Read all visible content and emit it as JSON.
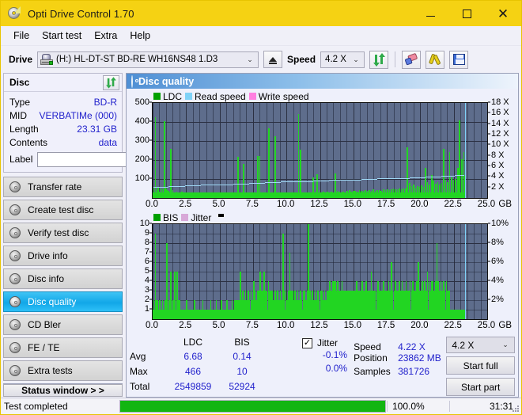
{
  "window": {
    "title": "Opti Drive Control 1.70",
    "icon": "disc-icon",
    "controls": {
      "minimize": "–",
      "maximize": "□",
      "close": "✕"
    }
  },
  "menu": {
    "items": [
      "File",
      "Start test",
      "Extra",
      "Help"
    ]
  },
  "toolbar": {
    "drive_label": "Drive",
    "drive_value": "(H:)   HL-DT-ST BD-RE  WH16NS48 1.D3",
    "eject": "eject-icon",
    "speed_label": "Speed",
    "speed_value": "4.2 X",
    "refresh": "refresh-icon",
    "eraser": "eraser-icon",
    "tools": "tools-icon",
    "save": "save-icon",
    "caret": "⌄"
  },
  "disc_panel": {
    "title": "Disc",
    "refresh_icon": "refresh-icon",
    "rows": [
      {
        "key": "Type",
        "value": "BD-R"
      },
      {
        "key": "MID",
        "value": "VERBATIMe (000)"
      },
      {
        "key": "Length",
        "value": "23.31 GB"
      },
      {
        "key": "Contents",
        "value": "data"
      }
    ],
    "label_key": "Label",
    "label_value": "",
    "label_placeholder": "",
    "label_button_icon": "cd-icon"
  },
  "nav": {
    "items": [
      {
        "label": "Transfer rate",
        "active": false
      },
      {
        "label": "Create test disc",
        "active": false
      },
      {
        "label": "Verify test disc",
        "active": false
      },
      {
        "label": "Drive info",
        "active": false
      },
      {
        "label": "Disc info",
        "active": false
      },
      {
        "label": "Disc quality",
        "active": true
      },
      {
        "label": "CD Bler",
        "active": false
      },
      {
        "label": "FE / TE",
        "active": false
      },
      {
        "label": "Extra tests",
        "active": false
      }
    ],
    "status_window": "Status window > >"
  },
  "panel": {
    "title": "Disc quality",
    "icon": "disc-quality-icon"
  },
  "chart_data": [
    {
      "type": "bar",
      "title": "LDC",
      "xlabel": "GB",
      "ylabel": "",
      "legend": [
        {
          "label": "LDC",
          "color": "#00a000"
        },
        {
          "label": "Read speed",
          "color": "#7fd2f7"
        },
        {
          "label": "Write speed",
          "color": "#ff7fe0"
        }
      ],
      "legend_position": "top-left",
      "grid": true,
      "xlim": [
        0,
        25.0
      ],
      "xticks": [
        "0.0",
        "2.5",
        "5.0",
        "7.5",
        "10.0",
        "12.5",
        "15.0",
        "17.5",
        "20.0",
        "22.5",
        "25.0"
      ],
      "xunit": "GB",
      "ylim": [
        0,
        500
      ],
      "yticks": [
        100,
        200,
        300,
        400,
        500
      ],
      "y2lim": [
        0,
        18
      ],
      "y2ticks": [
        "2 X",
        "4 X",
        "6 X",
        "8 X",
        "10 X",
        "12 X",
        "14 X",
        "16 X",
        "18 X"
      ],
      "series": [
        {
          "name": "LDC",
          "color": "#22d522",
          "x": [
            0.05,
            0.15,
            0.28,
            0.36,
            0.45,
            0.58,
            0.7,
            0.85,
            0.95,
            1.05,
            1.15,
            1.3,
            1.45,
            1.6,
            1.75,
            1.9,
            2.0,
            2.15,
            2.3,
            2.45,
            2.6,
            2.75,
            2.9,
            3.05,
            3.2,
            3.35,
            3.5,
            3.65,
            3.8,
            3.95,
            4.1,
            4.25,
            4.4,
            4.55,
            4.7,
            4.85,
            5.0,
            5.15,
            5.3,
            5.45,
            5.6,
            5.75,
            5.9,
            6.05,
            6.2,
            6.35,
            6.5,
            6.62,
            6.75,
            6.9,
            7.05,
            7.2,
            7.35,
            7.5,
            7.65,
            7.8,
            7.95,
            8.1,
            8.25,
            8.4,
            8.5,
            8.65,
            8.8,
            8.95,
            9.1,
            9.25,
            9.4,
            9.55,
            9.7,
            9.85,
            9.95,
            10.1,
            10.25,
            10.4,
            10.55,
            10.7,
            10.85,
            11.0,
            11.15,
            11.3,
            11.45,
            11.6,
            11.75,
            11.9,
            11.95,
            12.1,
            12.25,
            12.4,
            12.55,
            12.7,
            12.85,
            13.0,
            13.15,
            13.3,
            13.45,
            13.6,
            13.75,
            13.9,
            14.05,
            14.2,
            14.35,
            14.5,
            14.65,
            14.8,
            14.95,
            15.1,
            15.25,
            15.4,
            15.55,
            15.7,
            15.85,
            16.0,
            16.15,
            16.3,
            16.45,
            16.6,
            16.75,
            16.9,
            17.05,
            17.2,
            17.35,
            17.5,
            17.65,
            17.8,
            17.95,
            18.1,
            18.25,
            18.4,
            18.55,
            18.7,
            18.85,
            19.0,
            19.15,
            19.3,
            19.45,
            19.6,
            19.75,
            19.9,
            20.05,
            20.2,
            20.35,
            20.5,
            20.65,
            20.8,
            20.95,
            21.1,
            21.25,
            21.4,
            21.55,
            21.7,
            21.85,
            22.0,
            22.15,
            22.3,
            22.45,
            22.6,
            22.75,
            22.9,
            23.05,
            23.2,
            23.3
          ],
          "values": [
            60,
            425,
            40,
            58,
            35,
            52,
            45,
            404,
            50,
            42,
            38,
            258,
            40,
            30,
            34,
            28,
            30,
            32,
            26,
            24,
            28,
            22,
            26,
            24,
            20,
            22,
            26,
            24,
            20,
            22,
            24,
            20,
            26,
            22,
            20,
            24,
            18,
            20,
            24,
            22,
            20,
            24,
            26,
            20,
            22,
            218,
            28,
            24,
            180,
            26,
            30,
            24,
            28,
            22,
            26,
            220,
            222,
            30,
            24,
            28,
            26,
            368,
            30,
            24,
            325,
            28,
            26,
            30,
            24,
            28,
            26,
            30,
            24,
            26,
            30,
            24,
            440,
            255,
            28,
            24,
            30,
            26,
            24,
            28,
            110,
            32,
            125,
            40,
            30,
            34,
            30,
            34,
            28,
            32,
            30,
            130,
            36,
            32,
            28,
            34,
            30,
            36,
            40,
            34,
            36,
            38,
            34,
            40,
            36,
            38,
            42,
            38,
            40,
            36,
            44,
            38,
            40,
            42,
            38,
            44,
            40,
            46,
            42,
            44,
            48,
            44,
            46,
            50,
            44,
            48,
            52,
            268,
            80,
            62,
            70,
            56,
            64,
            58,
            66,
            60,
            160,
            82,
            70,
            120,
            90,
            75,
            85,
            70,
            80,
            260,
            95,
            85,
            240,
            110,
            90,
            100,
            160,
            410,
            205,
            240,
            120
          ]
        },
        {
          "name": "Read speed",
          "color": "#9fd8f5",
          "description": "rising stepped line from ~2.1X at 0 GB to ~4.3X at 23.3 GB",
          "x": [
            0.05,
            1.2,
            2.4,
            3.6,
            4.8,
            6.0,
            7.2,
            8.4,
            9.6,
            10.8,
            12.0,
            13.2,
            14.4,
            15.6,
            16.8,
            18.0,
            19.2,
            20.4,
            21.6,
            22.6,
            23.3
          ],
          "values": [
            2.1,
            2.2,
            2.35,
            2.5,
            2.6,
            2.75,
            2.85,
            3.0,
            3.1,
            3.2,
            3.3,
            3.4,
            3.5,
            3.6,
            3.7,
            3.8,
            3.9,
            4.0,
            4.15,
            4.3,
            4.3
          ]
        },
        {
          "name": "Write speed",
          "color": "#ff7fe0",
          "x": [],
          "values": []
        }
      ],
      "endline": {
        "x": 23.35,
        "label": "end-of-data marker",
        "color": "#7fd2f7"
      }
    },
    {
      "type": "bar",
      "title": "BIS",
      "xlabel": "GB",
      "legend": [
        {
          "label": "BIS",
          "color": "#00a000"
        },
        {
          "label": "Jitter",
          "color": "#d8a8d8"
        }
      ],
      "legend_position": "top-left",
      "grid": true,
      "xlim": [
        0,
        25.0
      ],
      "xticks": [
        "0.0",
        "2.5",
        "5.0",
        "7.5",
        "10.0",
        "12.5",
        "15.0",
        "17.5",
        "20.0",
        "22.5",
        "25.0"
      ],
      "xunit": "GB",
      "ylim": [
        0,
        10
      ],
      "yticks": [
        1,
        2,
        3,
        4,
        5,
        6,
        7,
        8,
        9,
        10
      ],
      "y2lim": [
        0,
        10
      ],
      "y2ticks": [
        "2%",
        "4%",
        "6%",
        "8%",
        "10%"
      ],
      "series": [
        {
          "name": "BIS",
          "color": "#22d522",
          "x": [
            0.05,
            0.15,
            0.25,
            0.3,
            0.4,
            0.5,
            0.6,
            0.7,
            0.8,
            0.9,
            1.0,
            1.1,
            1.2,
            1.3,
            1.4,
            1.5,
            1.6,
            1.7,
            1.8,
            1.9,
            2.0,
            2.1,
            2.2,
            2.3,
            2.4,
            2.5,
            2.6,
            2.7,
            2.8,
            2.9,
            3.0,
            3.1,
            3.2,
            3.3,
            3.4,
            3.5,
            3.6,
            3.7,
            3.8,
            3.9,
            4.0,
            4.1,
            4.2,
            4.3,
            4.4,
            4.5,
            4.6,
            4.7,
            4.8,
            4.9,
            5.0,
            5.1,
            5.2,
            5.3,
            5.4,
            5.5,
            5.6,
            5.7,
            5.8,
            5.9,
            6.0,
            6.1,
            6.2,
            6.3,
            6.4,
            6.5,
            6.6,
            6.7,
            6.8,
            6.9,
            7.0,
            7.1,
            7.2,
            7.3,
            7.4,
            7.5,
            7.6,
            7.7,
            7.8,
            7.9,
            8.0,
            8.1,
            8.2,
            8.3,
            8.4,
            8.5,
            8.6,
            8.7,
            8.8,
            8.9,
            9.0,
            9.1,
            9.2,
            9.3,
            9.4,
            9.5,
            9.6,
            9.7,
            9.8,
            9.9,
            10.0,
            10.1,
            10.2,
            10.3,
            10.4,
            10.5,
            10.6,
            10.7,
            10.8,
            10.9,
            11.0,
            11.1,
            11.2,
            11.3,
            11.4,
            11.5,
            11.6,
            11.7,
            11.8,
            11.9,
            12.0,
            12.1,
            12.2,
            12.3,
            12.4,
            12.5,
            12.6,
            12.7,
            12.8,
            12.9,
            13.0,
            13.1,
            13.2,
            13.3,
            13.4,
            13.5,
            13.6,
            13.7,
            13.8,
            13.9,
            14.0,
            14.1,
            14.2,
            14.3,
            14.4,
            14.5,
            14.6,
            14.7,
            14.8,
            14.9,
            15.0,
            15.1,
            15.2,
            15.3,
            15.4,
            15.5,
            15.6,
            15.7,
            15.8,
            15.9,
            16.0,
            16.1,
            16.2,
            16.3,
            16.4,
            16.5,
            16.6,
            16.7,
            16.8,
            16.9,
            17.0,
            17.1,
            17.2,
            17.3,
            17.4,
            17.5,
            17.6,
            17.7,
            17.8,
            17.9,
            18.0,
            18.1,
            18.2,
            18.3,
            18.4,
            18.5,
            18.6,
            18.7,
            18.8,
            18.9,
            19.0,
            19.1,
            19.2,
            19.3,
            19.4,
            19.5,
            19.6,
            19.7,
            19.8,
            19.9,
            20.0,
            20.1,
            20.2,
            20.3,
            20.4,
            20.5,
            20.6,
            20.7,
            20.8,
            20.9,
            21.0,
            21.1,
            21.2,
            21.3,
            21.4,
            21.5,
            21.6,
            21.7,
            21.8,
            21.9,
            22.0,
            22.1,
            22.2,
            22.3,
            22.4,
            22.5,
            22.6,
            22.7,
            22.8,
            22.9,
            23.0,
            23.1,
            23.2,
            23.3
          ],
          "values": [
            2,
            9,
            2,
            2,
            1,
            2,
            1,
            2,
            1,
            2,
            8,
            1,
            2,
            5,
            1,
            2,
            5,
            1,
            5,
            2,
            2,
            1,
            1,
            1,
            1,
            2,
            1,
            1,
            1,
            1,
            1,
            2,
            1,
            1,
            1,
            1,
            1,
            2,
            1,
            1,
            1,
            1,
            1,
            2,
            1,
            1,
            1,
            2,
            1,
            1,
            1,
            2,
            1,
            1,
            1,
            2,
            1,
            1,
            1,
            2,
            1,
            2,
            2,
            2,
            2,
            5,
            2,
            3,
            2,
            3,
            2,
            3,
            2,
            3,
            2,
            4,
            3,
            2,
            3,
            3,
            5,
            3,
            3,
            5,
            3,
            3,
            4,
            3,
            3,
            3,
            2,
            3,
            2,
            3,
            2,
            3,
            2,
            9,
            3,
            3,
            2,
            3,
            7,
            3,
            3,
            2,
            3,
            2,
            3,
            2,
            3,
            2,
            3,
            3,
            2,
            3,
            10,
            3,
            2,
            3,
            2,
            3,
            2,
            3,
            2,
            3,
            3,
            2,
            3,
            2,
            3,
            3,
            4,
            3,
            4,
            4,
            4,
            3,
            4,
            3,
            3,
            4,
            3,
            3,
            3,
            3,
            3,
            3,
            3,
            3,
            3,
            3,
            4,
            3,
            3,
            3,
            4,
            3,
            3,
            4,
            3,
            3,
            3,
            5,
            3,
            3,
            3,
            3,
            4,
            3,
            3,
            3,
            4,
            3,
            3,
            3,
            4,
            3,
            6,
            3,
            3,
            4,
            3,
            3,
            4,
            3,
            4,
            3,
            3,
            4,
            3,
            3,
            4,
            3,
            4,
            3,
            3,
            4,
            6,
            3,
            3,
            4,
            3,
            4,
            3,
            5,
            4,
            3,
            4,
            4,
            3,
            4,
            8,
            4,
            3,
            4,
            3,
            4,
            3,
            4,
            3,
            3
          ]
        },
        {
          "name": "Jitter",
          "color": "#d8a8d8",
          "x": [],
          "values": []
        }
      ],
      "endline": {
        "x": 23.35,
        "label": "end-of-data marker",
        "color": "#7fd2f7"
      }
    }
  ],
  "stats": {
    "headers": [
      "",
      "LDC",
      "BIS"
    ],
    "rows": [
      {
        "label": "Avg",
        "ldc": "6.68",
        "bis": "0.14"
      },
      {
        "label": "Max",
        "ldc": "466",
        "bis": "10"
      },
      {
        "label": "Total",
        "ldc": "2549859",
        "bis": "52924"
      }
    ],
    "jitter": {
      "label": "Jitter",
      "checked": true,
      "checkmark": "✓",
      "avg": "-0.1%",
      "max": "0.0%"
    },
    "speed": {
      "label": "Speed",
      "value": "4.22 X"
    },
    "position": {
      "label": "Position",
      "value": "23862 MB"
    },
    "samples": {
      "label": "Samples",
      "value": "381726"
    },
    "speed_select": "4.2 X",
    "start_full": "Start full",
    "start_part": "Start part"
  },
  "statusbar": {
    "text": "Test completed",
    "progress_percent": "100.0%",
    "progress_value": 100,
    "elapsed": "31:31"
  },
  "colors": {
    "title_bar": "#f5d213",
    "accent_blue": "#2222cc",
    "plot_bg": "#5e6d8c",
    "bar_green": "#22d522",
    "read_speed": "#9fd8f5",
    "nav_active": "#12a7e8",
    "progress_green": "#12b512"
  }
}
